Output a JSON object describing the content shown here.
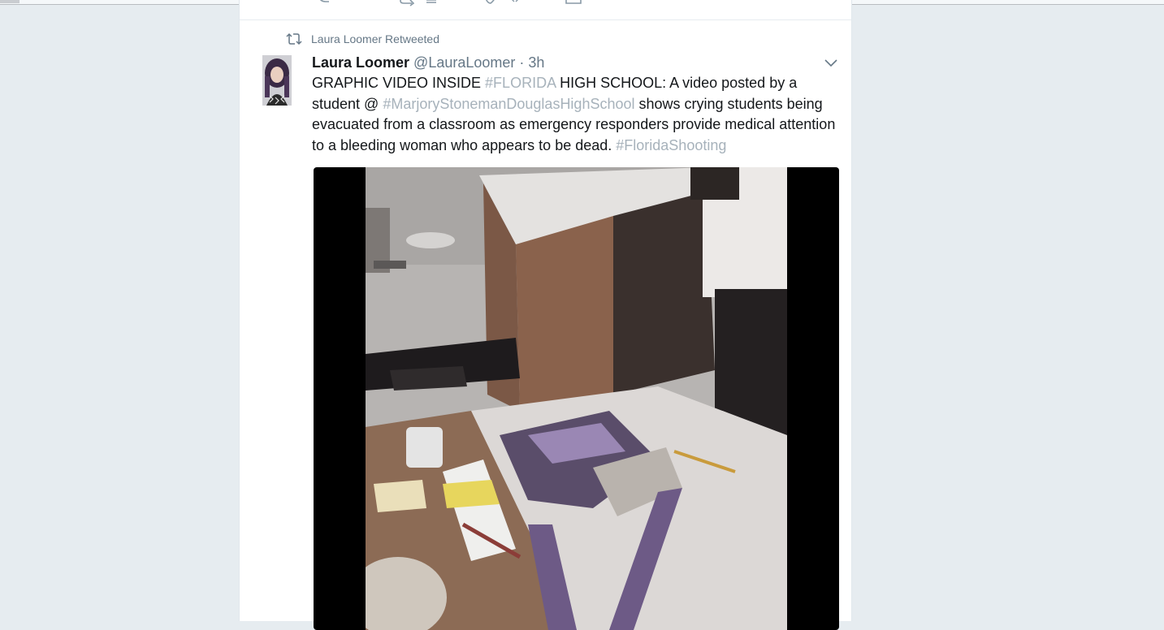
{
  "retweet_context": {
    "label": "Laura Loomer Retweeted"
  },
  "tweet": {
    "author_name": "Laura Loomer",
    "author_handle": "@LauraLoomer",
    "separator": "·",
    "timestamp": "3h",
    "text_segments": [
      {
        "text": "GRAPHIC VIDEO INSIDE ",
        "type": "plain"
      },
      {
        "text": "#FLORIDA",
        "type": "hashtag"
      },
      {
        "text": " HIGH SCHOOL: A video posted by a student @ ",
        "type": "plain"
      },
      {
        "text": "#MarjoryStonemanDouglasHighSchool",
        "type": "hashtag"
      },
      {
        "text": " shows crying students being evacuated from a classroom as emergency responders provide medical attention to a bleeding woman who appears to be dead. ",
        "type": "plain"
      },
      {
        "text": "#FloridaShooting",
        "type": "hashtag"
      }
    ],
    "media": {
      "kind": "video",
      "icon": "video-frame"
    }
  },
  "icons": {
    "retweet": "retweet-icon",
    "caret": "chevron-down-icon",
    "reply": "reply-icon",
    "like": "heart-icon",
    "message": "message-icon"
  },
  "colors": {
    "background": "#e6ecf0",
    "card": "#ffffff",
    "text": "#14171a",
    "secondary": "#657786",
    "hashtag": "#a7b2bb"
  }
}
